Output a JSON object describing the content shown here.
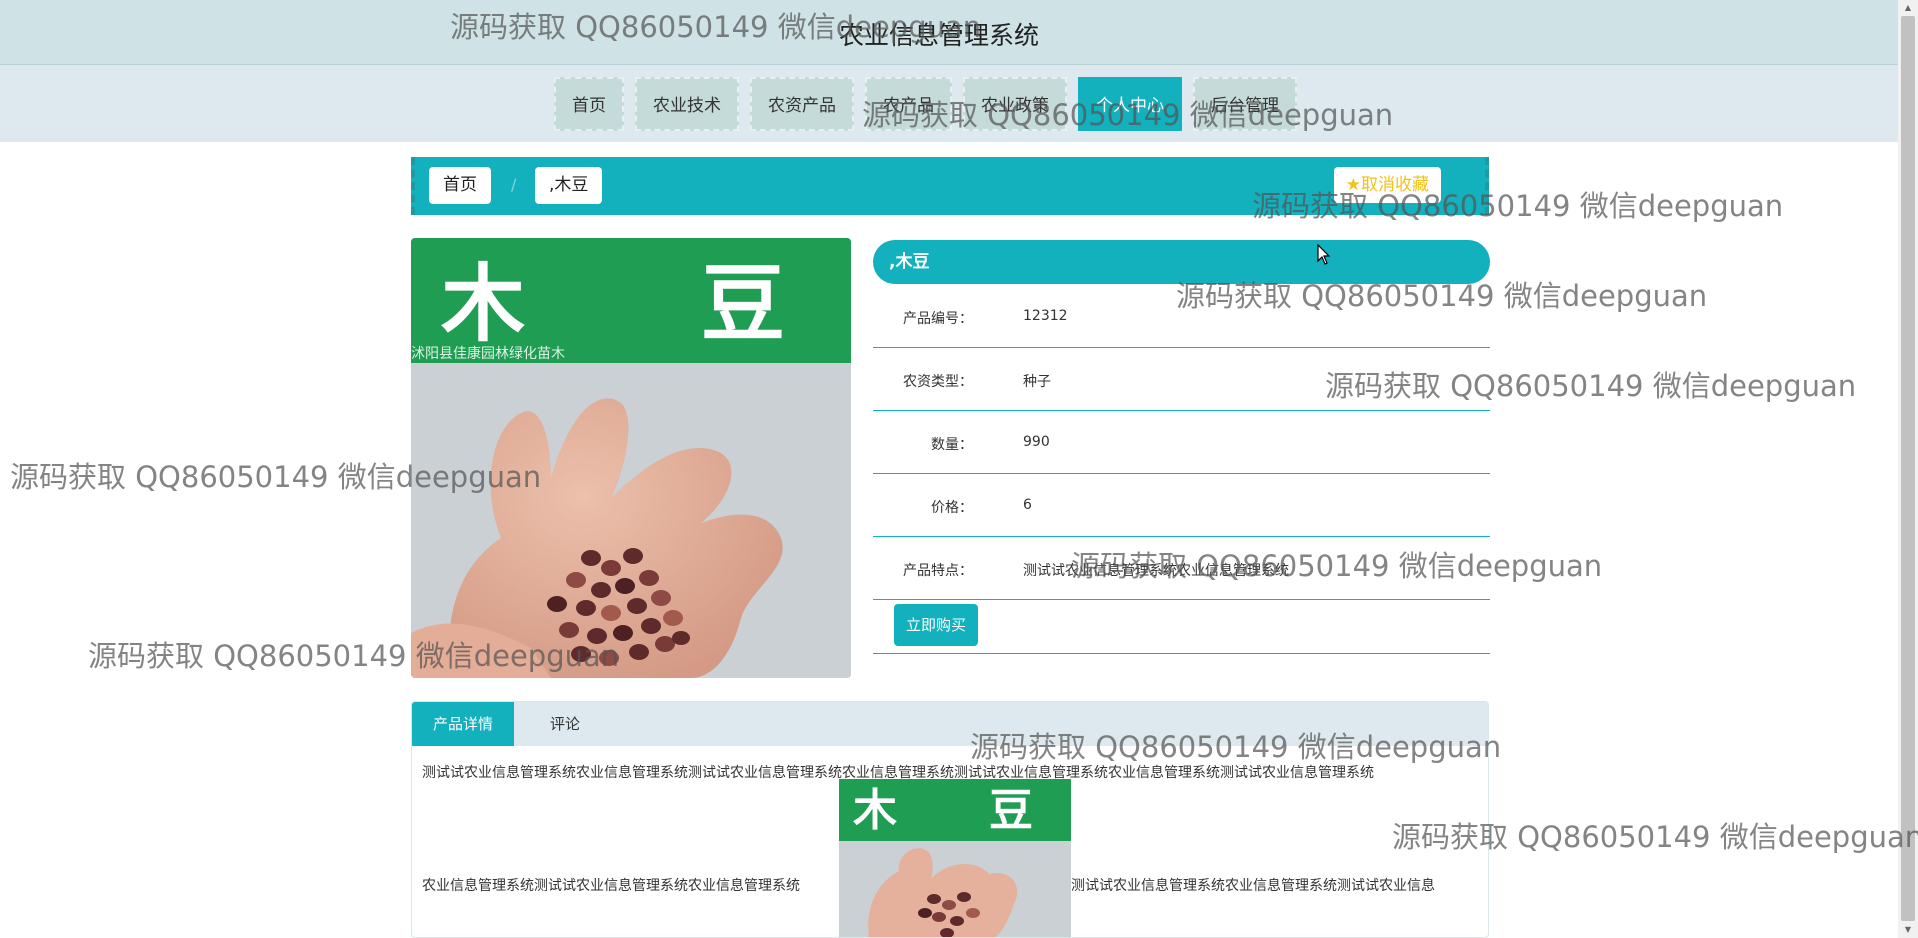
{
  "site": {
    "title": "农业信息管理系统"
  },
  "nav": {
    "items": [
      "首页",
      "农业技术",
      "农资产品",
      "农产品",
      "农业政策",
      "个人中心",
      "后台管理"
    ],
    "active_index": 5
  },
  "breadcrumb": {
    "home": "首页",
    "current": ",木豆"
  },
  "favorite": {
    "label": "★取消收藏"
  },
  "product": {
    "name": ",木豆",
    "image": {
      "banner_text": "木 豆",
      "sub_text": "沭阳县佳康园林绿化苗木"
    },
    "fields": [
      {
        "label": "产品编号：",
        "value": "12312"
      },
      {
        "label": "农资类型：",
        "value": "种子"
      },
      {
        "label": "数量：",
        "value": "990"
      },
      {
        "label": "价格：",
        "value": "6"
      },
      {
        "label": "产品特点：",
        "value": "测试试农业信息管理系统农业信息管理系统"
      }
    ],
    "buy_label": "立即购买"
  },
  "tabs": {
    "detail": "产品详情",
    "comment": "评论"
  },
  "detail": {
    "line1": "测试试农业信息管理系统农业信息管理系统测试试农业信息管理系统农业信息管理系统测试试农业信息管理系统农业信息管理系统测试试农业信息管理系统",
    "line2_left": "农业信息管理系统测试试农业信息管理系统农业信息管理系统",
    "line2_right": "测试试农业信息管理系统农业信息管理系统测试试农业信息"
  },
  "watermark": "源码获取 QQ86050149 微信deepguan",
  "colors": {
    "accent": "#13b0bd",
    "topbar": "#cfe3e6",
    "navbar": "#dde9ee",
    "star": "#f3c21b"
  }
}
